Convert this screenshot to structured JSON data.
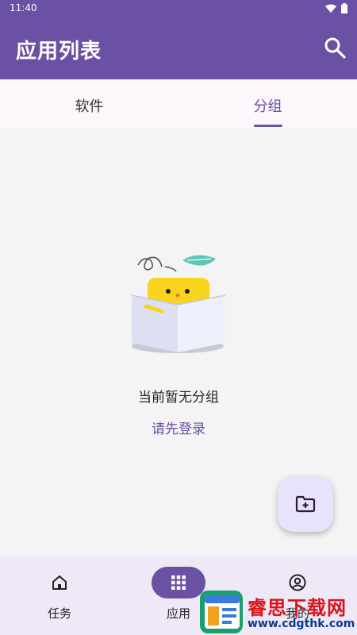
{
  "status_bar": {
    "time": "11:40",
    "wifi_icon": "wifi-icon",
    "battery_icon": "battery-icon"
  },
  "app_bar": {
    "title": "应用列表",
    "search_icon": "search-icon"
  },
  "tabs": [
    {
      "label": "软件",
      "active": false
    },
    {
      "label": "分组",
      "active": true
    }
  ],
  "empty_state": {
    "message": "当前暂无分组",
    "login_link": "请先登录",
    "illustration_icon": "empty-box-illustration"
  },
  "fab": {
    "icon": "folder-add-icon"
  },
  "bottom_nav": [
    {
      "label": "任务",
      "icon": "home-icon",
      "active": false
    },
    {
      "label": "应用",
      "icon": "apps-grid-icon",
      "active": true
    },
    {
      "label": "我的",
      "icon": "account-circle-icon",
      "active": false
    }
  ],
  "watermark": {
    "title": "睿思下载网",
    "url": "www.cdgthk.com"
  },
  "colors": {
    "primary": "#6a51a3",
    "tab_bg": "#fdf6fb",
    "content_bg": "#f4f4f4",
    "nav_bg": "#efe8f6",
    "fab_bg": "#e9e2fb"
  }
}
